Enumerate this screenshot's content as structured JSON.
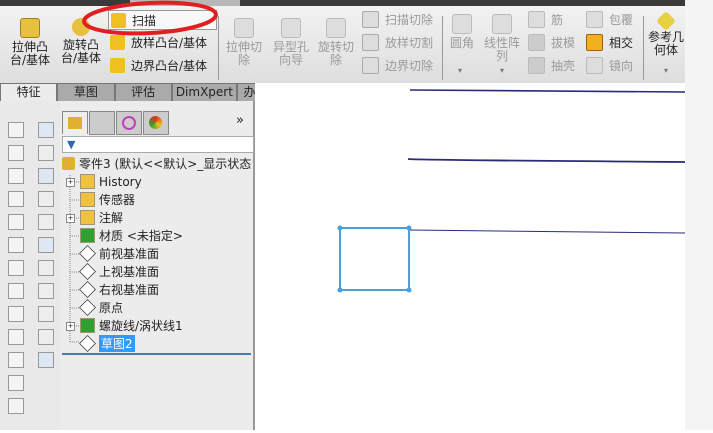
{
  "ribbon": {
    "extrude_boss": "拉伸凸\n台/基体",
    "revolve_boss": "旋转凸\n台/基体",
    "sweep": "扫描",
    "loft_boss": "放样凸台/基体",
    "boundary_boss": "边界凸台/基体",
    "extrude_cut": "拉伸切\n除",
    "hole_wizard": "异型孔\n向导",
    "revolve_cut": "旋转切\n除",
    "swept_cut": "扫描切除",
    "lofted_cut": "放样切割",
    "boundary_cut": "边界切除",
    "fillet": "圆角",
    "linear_pattern": "线性阵\n列",
    "rib": "筋",
    "draft": "拔模",
    "shell": "抽壳",
    "wrap": "包覆",
    "intersect": "相交",
    "mirror": "镜向",
    "ref_geometry": "参考几\n何体"
  },
  "tabs": [
    "特征",
    "草图",
    "评估",
    "DimXpert",
    "办公室产品"
  ],
  "tree": {
    "root": "零件3  (默认<<默认>_显示状态",
    "items": [
      "History",
      "传感器",
      "注解",
      "材质 <未指定>",
      "前视基准面",
      "上视基准面",
      "右视基准面",
      "原点",
      "螺旋线/涡状线1",
      "草图2"
    ],
    "expand_label": "»"
  },
  "colors": {
    "highlight": "#3399ff",
    "sketch": "#4a9fdc",
    "annotation": "#e02020"
  }
}
